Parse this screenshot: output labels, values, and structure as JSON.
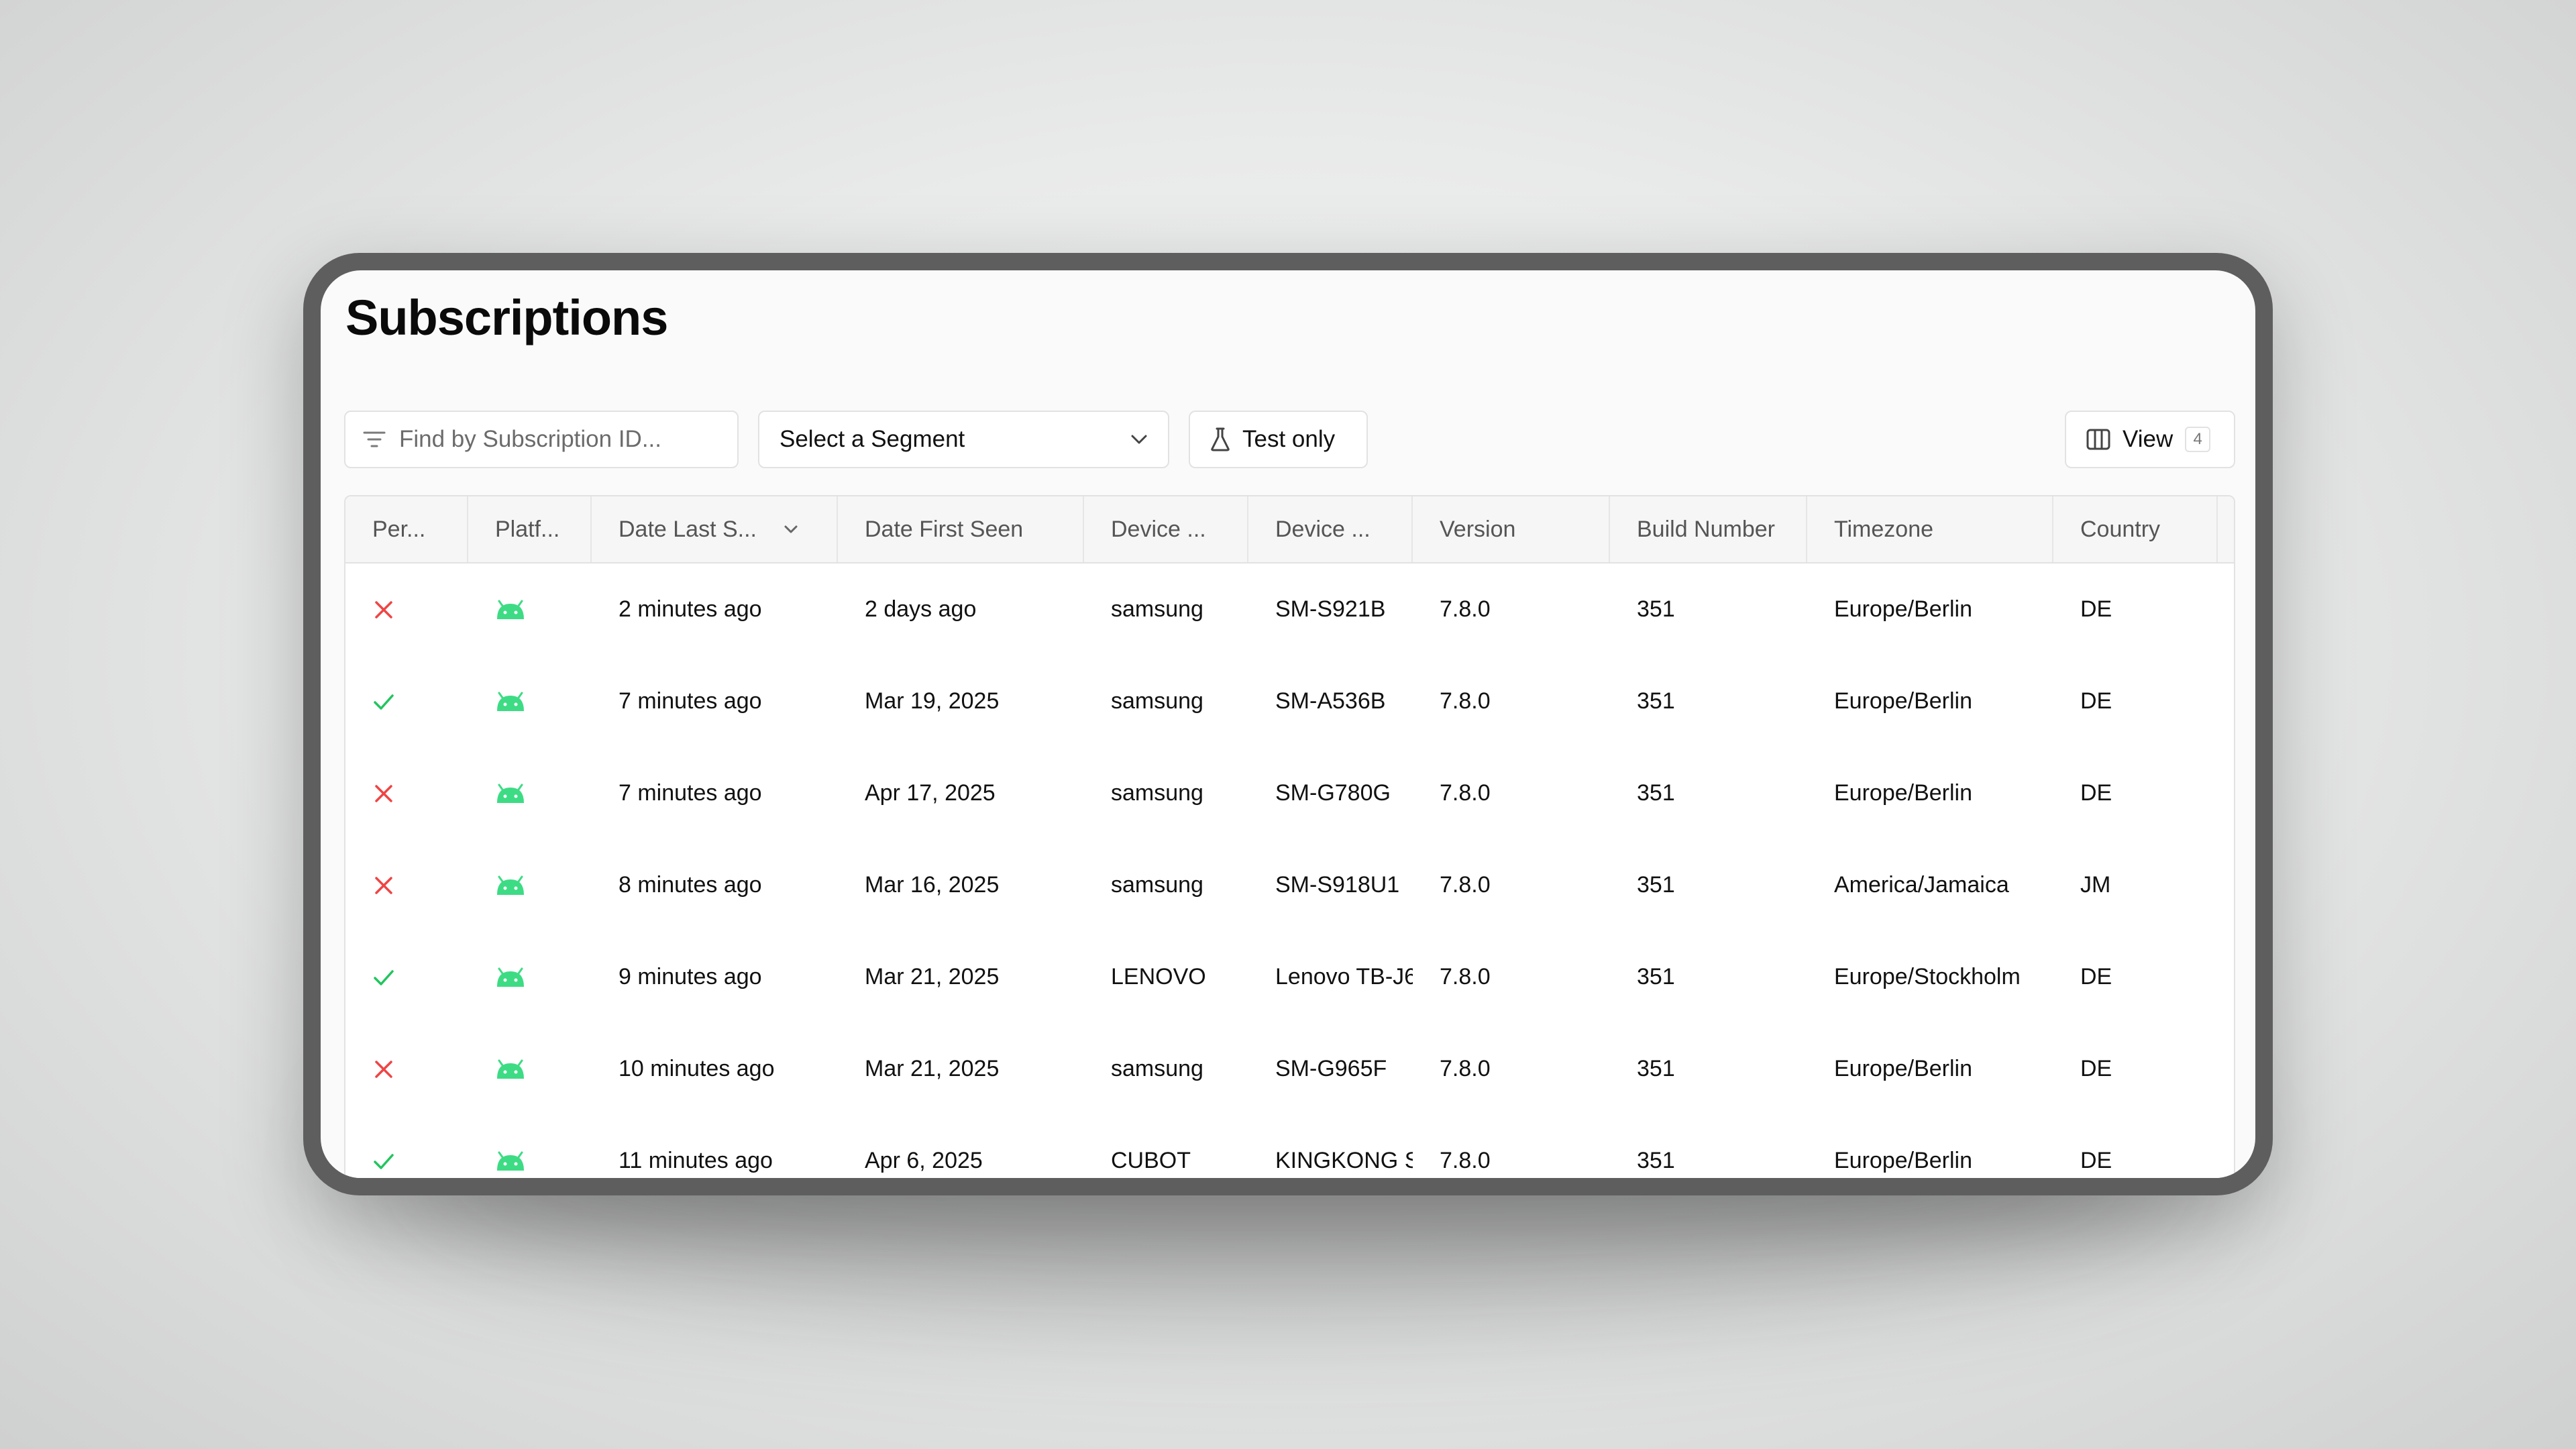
{
  "page": {
    "title": "Subscriptions"
  },
  "toolbar": {
    "search_placeholder": "Find by Subscription ID...",
    "segment_label": "Select a Segment",
    "test_only_label": "Test only",
    "view_label": "View",
    "view_count": "4"
  },
  "table": {
    "headers": [
      "Per...",
      "Platf...",
      "Date Last S...",
      "Date First Seen",
      "Device ...",
      "Device ...",
      "Version",
      "Build Number",
      "Timezone",
      "Country"
    ],
    "sorted_column": "Date Last S...",
    "rows": [
      {
        "status": "denied",
        "status_icon": "x-icon",
        "platform_icon": "android-icon",
        "last_seen": "2 minutes ago",
        "first_seen": "2 days ago",
        "manufacturer": "samsung",
        "model": "SM-S921B",
        "version": "7.8.0",
        "build": "351",
        "timezone": "Europe/Berlin",
        "country": "DE"
      },
      {
        "status": "granted",
        "status_icon": "check-icon",
        "platform_icon": "android-icon",
        "last_seen": "7 minutes ago",
        "first_seen": "Mar 19, 2025",
        "manufacturer": "samsung",
        "model": "SM-A536B",
        "version": "7.8.0",
        "build": "351",
        "timezone": "Europe/Berlin",
        "country": "DE"
      },
      {
        "status": "denied",
        "status_icon": "x-icon",
        "platform_icon": "android-icon",
        "last_seen": "7 minutes ago",
        "first_seen": "Apr 17, 2025",
        "manufacturer": "samsung",
        "model": "SM-G780G",
        "version": "7.8.0",
        "build": "351",
        "timezone": "Europe/Berlin",
        "country": "DE"
      },
      {
        "status": "denied",
        "status_icon": "x-icon",
        "platform_icon": "android-icon",
        "last_seen": "8 minutes ago",
        "first_seen": "Mar 16, 2025",
        "manufacturer": "samsung",
        "model": "SM-S918U1",
        "version": "7.8.0",
        "build": "351",
        "timezone": "America/Jamaica",
        "country": "JM"
      },
      {
        "status": "granted",
        "status_icon": "check-icon",
        "platform_icon": "android-icon",
        "last_seen": "9 minutes ago",
        "first_seen": "Mar 21, 2025",
        "manufacturer": "LENOVO",
        "model": "Lenovo TB-J6",
        "version": "7.8.0",
        "build": "351",
        "timezone": "Europe/Stockholm",
        "country": "DE"
      },
      {
        "status": "denied",
        "status_icon": "x-icon",
        "platform_icon": "android-icon",
        "last_seen": "10 minutes ago",
        "first_seen": "Mar 21, 2025",
        "manufacturer": "samsung",
        "model": "SM-G965F",
        "version": "7.8.0",
        "build": "351",
        "timezone": "Europe/Berlin",
        "country": "DE"
      },
      {
        "status": "granted",
        "status_icon": "check-icon",
        "platform_icon": "android-icon",
        "last_seen": "11 minutes ago",
        "first_seen": "Apr 6, 2025",
        "manufacturer": "CUBOT",
        "model": "KINGKONG S",
        "version": "7.8.0",
        "build": "351",
        "timezone": "Europe/Berlin",
        "country": "DE"
      }
    ]
  },
  "colors": {
    "granted": "#22c55e",
    "denied": "#ef4444",
    "android": "#3ddc84"
  }
}
